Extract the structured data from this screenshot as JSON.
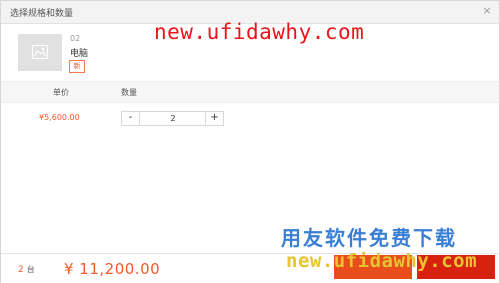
{
  "dialog": {
    "title": "选择规格和数量"
  },
  "watermark": {
    "top_url": "new.ufidawhy.com",
    "bottom_cn": "用友软件免费下载",
    "bottom_url": "new.ufidawhy.com"
  },
  "product": {
    "code": "02",
    "name": "电脑",
    "tag": "新"
  },
  "table": {
    "headers": {
      "price": "单价",
      "quantity": "数量"
    },
    "row": {
      "price": "¥5,600.00",
      "quantity": "2"
    }
  },
  "stepper": {
    "minus": "-",
    "plus": "+"
  },
  "footer": {
    "count": "2",
    "unit": "台",
    "total": "¥ 11,200.00"
  },
  "colors": {
    "accent": "#f25a2a",
    "cart_button": "#e84d1c",
    "buy_button": "#d6220f",
    "watermark_red": "#e8141c",
    "watermark_blue": "#3a7fd6",
    "watermark_yellow": "#e8c430"
  },
  "icons": {
    "thumbnail": "image-placeholder-icon",
    "close": "close-icon"
  }
}
